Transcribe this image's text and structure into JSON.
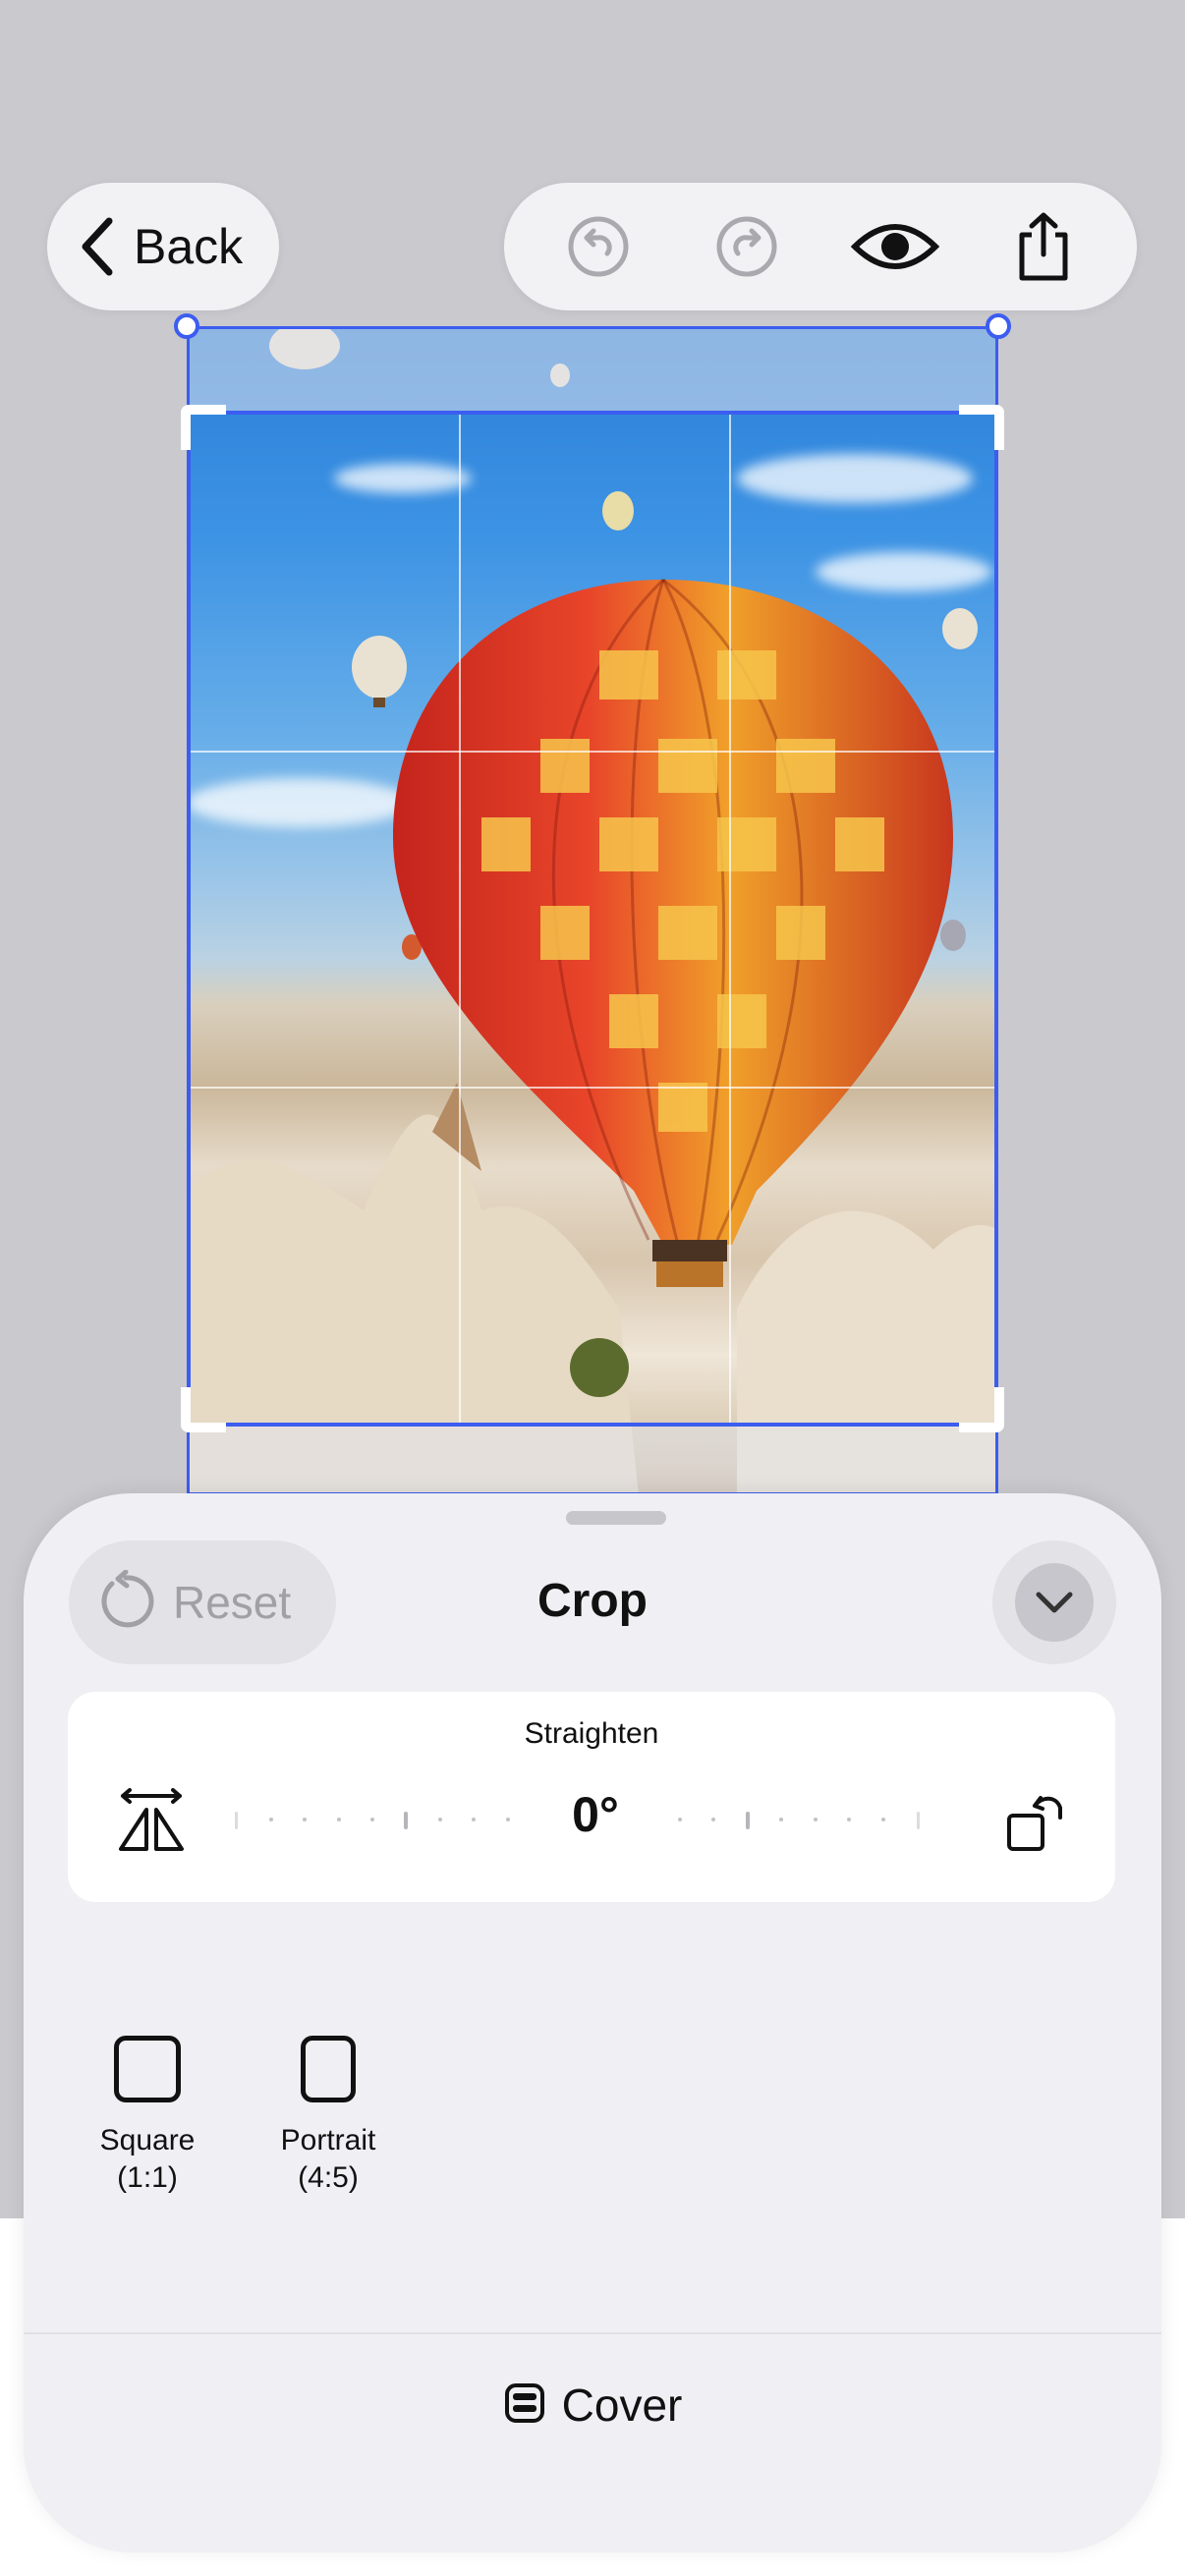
{
  "toolbar": {
    "back_label": "Back",
    "undo_icon": "undo-icon",
    "redo_icon": "redo-icon",
    "preview_icon": "eye-icon",
    "share_icon": "share-icon"
  },
  "editor": {
    "image_subject": "hot-air-balloon-photo",
    "accent_color": "#3c5df0"
  },
  "sheet": {
    "reset_label": "Reset",
    "title": "Crop",
    "straighten": {
      "label": "Straighten",
      "angle": "0°"
    },
    "aspect_options": [
      {
        "name": "Square",
        "ratio": "(1:1)"
      },
      {
        "name": "Portrait",
        "ratio": "(4:5)"
      }
    ],
    "cover_label": "Cover"
  }
}
